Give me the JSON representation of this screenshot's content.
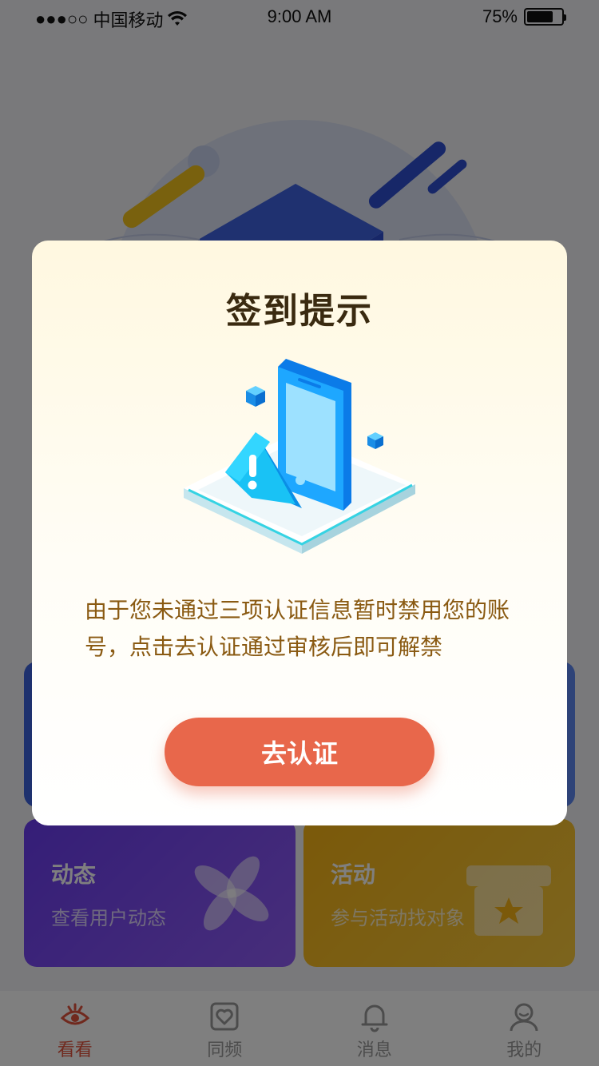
{
  "status_bar": {
    "signal": "●●●○○",
    "carrier": "中国移动",
    "time": "9:00 AM",
    "battery_percent": "75%",
    "battery_level": 0.75
  },
  "cards": {
    "dynamic": {
      "title": "动态",
      "subtitle": "查看用户动态"
    },
    "activity": {
      "title": "活动",
      "subtitle": "参与活动找对象"
    }
  },
  "tabs": [
    {
      "label": "看看",
      "icon": "eye-icon",
      "active": true
    },
    {
      "label": "同频",
      "icon": "heart-frame-icon",
      "active": false
    },
    {
      "label": "消息",
      "icon": "bell-icon",
      "active": false
    },
    {
      "label": "我的",
      "icon": "user-icon",
      "active": false
    }
  ],
  "modal": {
    "title": "签到提示",
    "illustration_icon": "phone-warning-icon",
    "message": "由于您未通过三项认证信息暂时禁用您的账号，点击去认证通过审核后即可解禁",
    "button_label": "去认证"
  },
  "colors": {
    "accent": "#e8674b",
    "tab_active": "#e0533c",
    "message_text": "#8a5a12",
    "overlay": "rgba(0,0,0,0.5)"
  }
}
